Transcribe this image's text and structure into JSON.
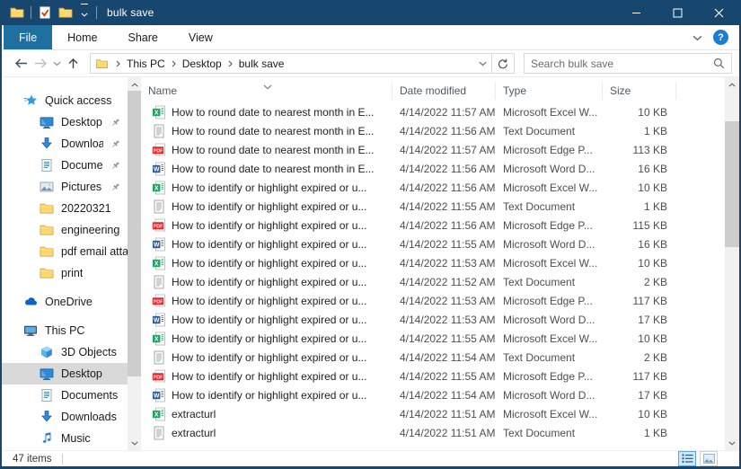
{
  "window": {
    "title": "bulk save"
  },
  "titlebar": {
    "title": "bulk save",
    "window_icon": "folder",
    "qat_properties_icon": "check-doc",
    "qat_newfolder_icon": "folder",
    "qat_customize_icon": "chevron-down",
    "minimize_icon": "minimize",
    "maximize_icon": "maximize",
    "close_icon": "close"
  },
  "ribbon": {
    "tabs": [
      {
        "label": "File",
        "active": true
      },
      {
        "label": "Home",
        "active": false
      },
      {
        "label": "Share",
        "active": false
      },
      {
        "label": "View",
        "active": false
      }
    ],
    "expand_icon": "chevron-down",
    "help_label": "?"
  },
  "toolbar": {
    "back_icon": "arrow-left",
    "forward_icon": "arrow-right",
    "recent_icon": "chevron-down",
    "up_icon": "arrow-up",
    "breadcrumb_icon": "folder",
    "breadcrumb": [
      "This PC",
      "Desktop",
      "bulk save"
    ],
    "address_dropdown_icon": "chevron-down",
    "refresh_icon": "refresh",
    "search_placeholder": "Search bulk save",
    "search_icon": "search"
  },
  "sidebar": {
    "items": [
      {
        "label": "Quick access",
        "icon": "quick-access",
        "depth": 0,
        "pinned": false,
        "selected": false,
        "gap": false
      },
      {
        "label": "Desktop",
        "icon": "desktop",
        "depth": 1,
        "pinned": true,
        "selected": false,
        "gap": false
      },
      {
        "label": "Downloads",
        "icon": "downloads",
        "depth": 1,
        "pinned": true,
        "selected": false,
        "gap": false
      },
      {
        "label": "Documents",
        "icon": "documents",
        "depth": 1,
        "pinned": true,
        "selected": false,
        "gap": false
      },
      {
        "label": "Pictures",
        "icon": "pictures",
        "depth": 1,
        "pinned": true,
        "selected": false,
        "gap": false
      },
      {
        "label": "20220321",
        "icon": "folder",
        "depth": 1,
        "pinned": false,
        "selected": false,
        "gap": false
      },
      {
        "label": "engineering",
        "icon": "folder",
        "depth": 1,
        "pinned": false,
        "selected": false,
        "gap": false
      },
      {
        "label": "pdf email attach",
        "icon": "folder",
        "depth": 1,
        "pinned": false,
        "selected": false,
        "gap": false
      },
      {
        "label": "print",
        "icon": "folder",
        "depth": 1,
        "pinned": false,
        "selected": false,
        "gap": false
      },
      {
        "label": "OneDrive",
        "icon": "onedrive",
        "depth": 0,
        "pinned": false,
        "selected": false,
        "gap": true
      },
      {
        "label": "This PC",
        "icon": "this-pc",
        "depth": 0,
        "pinned": false,
        "selected": false,
        "gap": true
      },
      {
        "label": "3D Objects",
        "icon": "objects-3d",
        "depth": 1,
        "pinned": false,
        "selected": false,
        "gap": false
      },
      {
        "label": "Desktop",
        "icon": "desktop",
        "depth": 1,
        "pinned": false,
        "selected": true,
        "gap": false
      },
      {
        "label": "Documents",
        "icon": "documents",
        "depth": 1,
        "pinned": false,
        "selected": false,
        "gap": false
      },
      {
        "label": "Downloads",
        "icon": "downloads",
        "depth": 1,
        "pinned": false,
        "selected": false,
        "gap": false
      },
      {
        "label": "Music",
        "icon": "music",
        "depth": 1,
        "pinned": false,
        "selected": false,
        "gap": false
      }
    ]
  },
  "list": {
    "columns": [
      {
        "label": "Name",
        "sorted": "asc"
      },
      {
        "label": "Date modified"
      },
      {
        "label": "Type"
      },
      {
        "label": "Size"
      }
    ],
    "sort_icon": "chevron-down",
    "rows": [
      {
        "icon": "excel",
        "name": "How to round date to nearest month in E...",
        "date": "4/14/2022 11:57 AM",
        "type": "Microsoft Excel W...",
        "size": "10 KB"
      },
      {
        "icon": "text",
        "name": "How to round date to nearest month in E...",
        "date": "4/14/2022 11:56 AM",
        "type": "Text Document",
        "size": "1 KB"
      },
      {
        "icon": "pdf",
        "name": "How to round date to nearest month in E...",
        "date": "4/14/2022 11:57 AM",
        "type": "Microsoft Edge P...",
        "size": "113 KB"
      },
      {
        "icon": "word",
        "name": "How to round date to nearest month in E...",
        "date": "4/14/2022 11:56 AM",
        "type": "Microsoft Word D...",
        "size": "16 KB"
      },
      {
        "icon": "excel",
        "name": "How to identify or highlight expired or u...",
        "date": "4/14/2022 11:56 AM",
        "type": "Microsoft Excel W...",
        "size": "10 KB"
      },
      {
        "icon": "text",
        "name": "How to identify or highlight expired or u...",
        "date": "4/14/2022 11:55 AM",
        "type": "Text Document",
        "size": "1 KB"
      },
      {
        "icon": "pdf",
        "name": "How to identify or highlight expired or u...",
        "date": "4/14/2022 11:56 AM",
        "type": "Microsoft Edge P...",
        "size": "115 KB"
      },
      {
        "icon": "word",
        "name": "How to identify or highlight expired or u...",
        "date": "4/14/2022 11:55 AM",
        "type": "Microsoft Word D...",
        "size": "16 KB"
      },
      {
        "icon": "excel",
        "name": "How to identify or highlight expired or u...",
        "date": "4/14/2022 11:53 AM",
        "type": "Microsoft Excel W...",
        "size": "10 KB"
      },
      {
        "icon": "text",
        "name": "How to identify or highlight expired or u...",
        "date": "4/14/2022 11:52 AM",
        "type": "Text Document",
        "size": "2 KB"
      },
      {
        "icon": "pdf",
        "name": "How to identify or highlight expired or u...",
        "date": "4/14/2022 11:53 AM",
        "type": "Microsoft Edge P...",
        "size": "117 KB"
      },
      {
        "icon": "word",
        "name": "How to identify or highlight expired or u...",
        "date": "4/14/2022 11:53 AM",
        "type": "Microsoft Word D...",
        "size": "17 KB"
      },
      {
        "icon": "excel",
        "name": "How to identify or highlight expired or u...",
        "date": "4/14/2022 11:55 AM",
        "type": "Microsoft Excel W...",
        "size": "10 KB"
      },
      {
        "icon": "text",
        "name": "How to identify or highlight expired or u...",
        "date": "4/14/2022 11:54 AM",
        "type": "Text Document",
        "size": "2 KB"
      },
      {
        "icon": "pdf",
        "name": "How to identify or highlight expired or u...",
        "date": "4/14/2022 11:55 AM",
        "type": "Microsoft Edge P...",
        "size": "117 KB"
      },
      {
        "icon": "word",
        "name": "How to identify or highlight expired or u...",
        "date": "4/14/2022 11:54 AM",
        "type": "Microsoft Word D...",
        "size": "17 KB"
      },
      {
        "icon": "excel",
        "name": "extracturl",
        "date": "4/14/2022 11:51 AM",
        "type": "Microsoft Excel W...",
        "size": "10 KB"
      },
      {
        "icon": "text",
        "name": "extracturl",
        "date": "4/14/2022 11:51 AM",
        "type": "Text Document",
        "size": "1 KB"
      }
    ]
  },
  "statusbar": {
    "count": "47 items",
    "view_details_icon": "view-details",
    "view_thumbnails_icon": "view-thumbnails"
  },
  "colors": {
    "titlebar": "#17466F",
    "active_tab": "#20709F",
    "accent_blue": "#2F88D8",
    "folder_yellow": "#FDD870",
    "excel_green": "#21A366",
    "word_blue": "#2B579A",
    "pdf_red": "#E5252A",
    "selected_gray": "#D9D9D9"
  }
}
